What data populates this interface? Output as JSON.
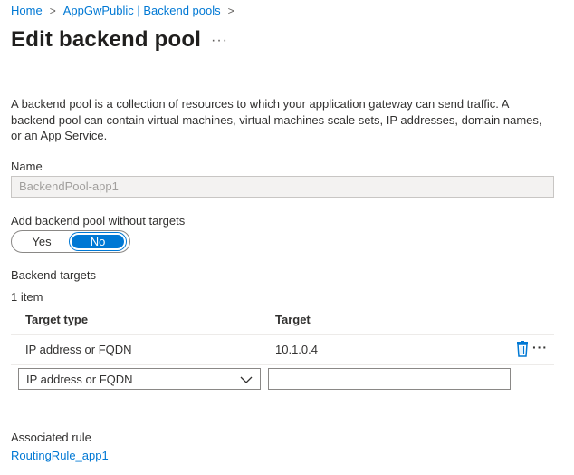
{
  "breadcrumb": {
    "home": "Home",
    "separator": ">",
    "parent": "AppGwPublic | Backend pools",
    "trailing_separator": ">"
  },
  "page": {
    "title": "Edit backend pool",
    "more_label": "···",
    "description": "A backend pool is a collection of resources to which your application gateway can send traffic. A backend pool can contain virtual machines, virtual machines scale sets, IP addresses, domain names, or an App Service."
  },
  "name_field": {
    "label": "Name",
    "value": "BackendPool-app1"
  },
  "targets_toggle": {
    "label": "Add backend pool without targets",
    "options": [
      "Yes",
      "No"
    ],
    "selected": "No"
  },
  "backend_targets": {
    "heading": "Backend targets",
    "count": "1 item",
    "columns": [
      "Target type",
      "Target"
    ],
    "rows": [
      {
        "type": "IP address or FQDN",
        "target": "10.1.0.4"
      }
    ],
    "new_row": {
      "type_selected": "IP address or FQDN",
      "target_value": ""
    },
    "row_more_label": "···"
  },
  "associated_rule": {
    "label": "Associated rule",
    "link": "RoutingRule_app1"
  },
  "colors": {
    "accent": "#0078d4",
    "text": "#323130",
    "disabled_bg": "#f3f2f1",
    "border": "#8a8886"
  },
  "icons": {
    "row_delete": "trash-icon",
    "select_chevron": "chevron-down-icon",
    "row_more": "more-dots-icon"
  }
}
